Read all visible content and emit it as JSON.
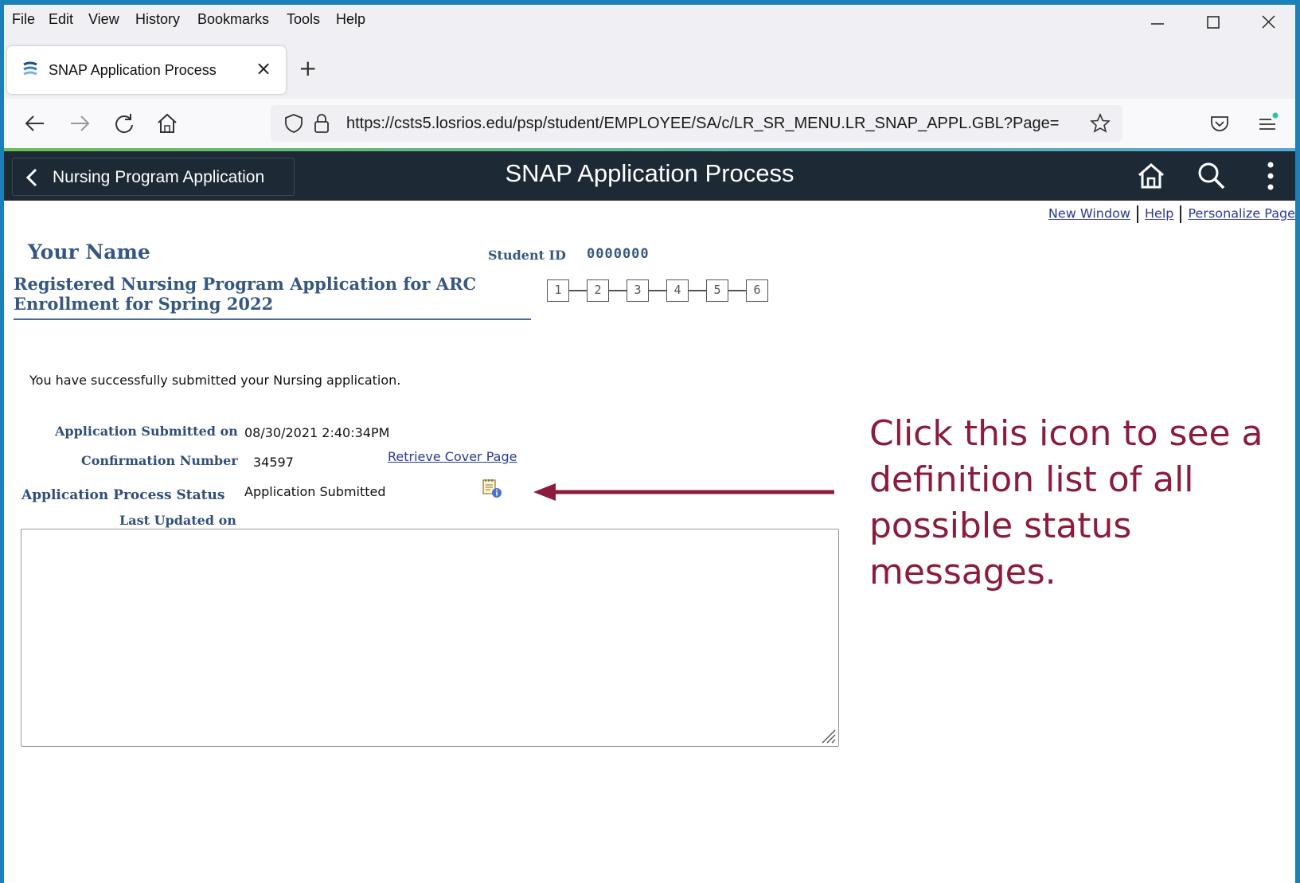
{
  "browser": {
    "menu": [
      "File",
      "Edit",
      "View",
      "History",
      "Bookmarks",
      "Tools",
      "Help"
    ],
    "tab_title": "SNAP Application Process",
    "url": "https://csts5.losrios.edu/psp/student/EMPLOYEE/SA/c/LR_SR_MENU.LR_SNAP_APPL.GBL?Page="
  },
  "header": {
    "back_label": "Nursing Program Application",
    "title": "SNAP Application Process"
  },
  "links": {
    "new_window": "New Window",
    "help": "Help",
    "personalize": "Personalize Page"
  },
  "student": {
    "name": "Your Name",
    "id_label": "Student ID",
    "id_value": "0000000"
  },
  "application": {
    "title": "Registered Nursing Program Application for ARC Enrollment for Spring 2022",
    "steps": [
      "1",
      "2",
      "3",
      "4",
      "5",
      "6"
    ],
    "success_message": "You have successfully submitted your Nursing application.",
    "submitted_label": "Application Submitted on",
    "submitted_value": "08/30/2021  2:40:34PM",
    "confirmation_label": "Confirmation Number",
    "confirmation_value": "34597",
    "cover_link": "Retrieve Cover Page",
    "status_label": "Application Process Status",
    "status_value": "Application Submitted",
    "updated_label": "Last Updated on"
  },
  "annotation": {
    "callout": "Click this icon to see a definition list of all possible status messages.",
    "color": "#8b1c3c"
  }
}
